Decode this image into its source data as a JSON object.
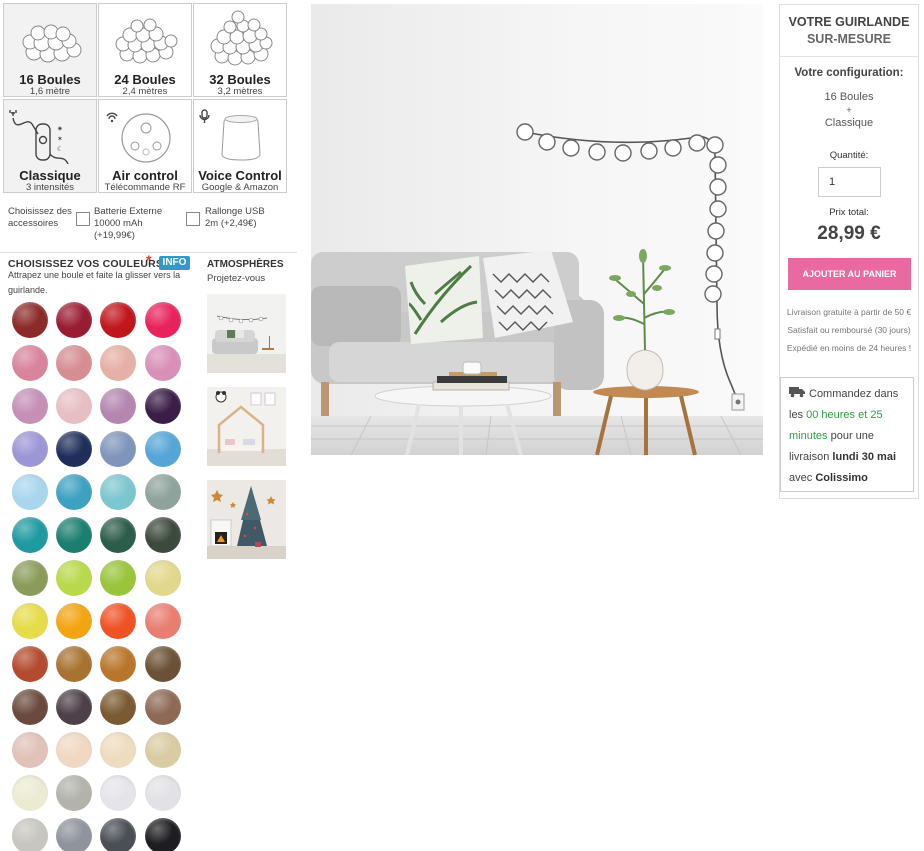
{
  "options": [
    {
      "title": "16 Boules",
      "sub": "1,6 mètre"
    },
    {
      "title": "24 Boules",
      "sub": "2,4 mètres"
    },
    {
      "title": "32 Boules",
      "sub": "3,2 mètres"
    },
    {
      "title": "Classique",
      "sub": "3 intensités"
    },
    {
      "title": "Air control",
      "sub": "Télécommande RF"
    },
    {
      "title": "Voice Control",
      "sub": "Google & Amazon"
    }
  ],
  "accessories": {
    "label": "Choisissez des accessoires",
    "battery": "Batterie Externe 10000 mAh (+19,99€)",
    "usb": "Rallonge USB 2m (+2,49€)"
  },
  "colors": {
    "title": "CHOISISSEZ VOS COULEURS",
    "required": "*",
    "info": "INFO",
    "help": "Attrapez une boule et faite la glisser vers la guirlande.",
    "balls": [
      "#8b2a28",
      "#9a1c33",
      "#c0161c",
      "#e8225a",
      "#d9839d",
      "#d68e93",
      "#e6b0a6",
      "#d990b8",
      "#c58fb6",
      "#e7bfc3",
      "#b486b0",
      "#3a1e48",
      "#9b96d6",
      "#1f2e5a",
      "#7f95bb",
      "#55a5d6",
      "#a9d6ee",
      "#3ea1c2",
      "#7cc7cf",
      "#8ea39c",
      "#1e9aa0",
      "#1b7f6f",
      "#2c5c4a",
      "#3c4a3c",
      "#8a9c5a",
      "#b8d94a",
      "#9ac43a",
      "#e2d88c",
      "#e6dc4a",
      "#f2a411",
      "#ef5225",
      "#ea7d72",
      "#b44a2e",
      "#a87330",
      "#b9762b",
      "#6b5136",
      "#6a4a3e",
      "#4d4048",
      "#7a5a32",
      "#8e6a55",
      "#e0c2b8",
      "#f0d8c2",
      "#eedcc0",
      "#d9cba2",
      "#ecebd2",
      "#b3b3ac",
      "#e4e4ea",
      "#e2e2e6",
      "#c8c6c0",
      "#8f949c",
      "#4a4e55",
      "#1e1e22"
    ]
  },
  "atmospheres": {
    "title": "ATMOSPHÈRES",
    "subtitle": "Projetez-vous"
  },
  "summary": {
    "title1": "VOTRE GUIRLANDE",
    "title2": "SUR-MESURE",
    "config_label": "Votre configuration:",
    "config_line1": "16 Boules",
    "config_plus": "+",
    "config_line2": "Classique",
    "qty_label": "Quantité:",
    "qty_value": "1",
    "price_label": "Prix total:",
    "price": "28,99 €",
    "cart_button": "AJOUTER AU PANIER",
    "note1": "Livraison gratuite à partir de 50 €",
    "note2": "Satisfait ou remboursé (30 jours)",
    "note3": "Expédié en moins de 24 heures !"
  },
  "shipping": {
    "p1": "Commandez dans les",
    "time": "00 heures et 25 minutes",
    "p2": "pour une livraison",
    "date": "lundi 30 mai",
    "p3": "avec",
    "carrier": "Colissimo"
  }
}
